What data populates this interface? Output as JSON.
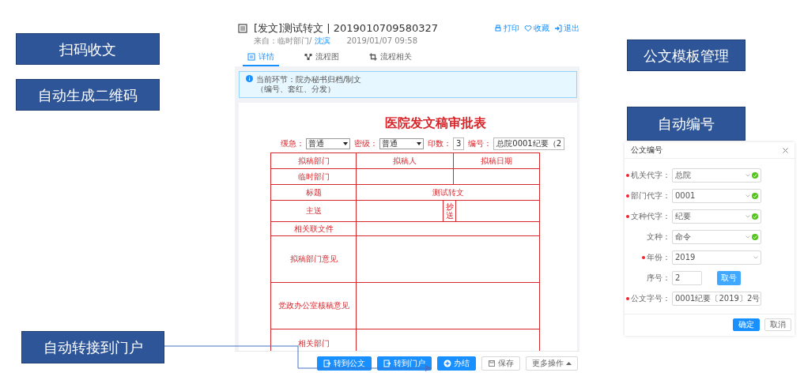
{
  "callouts": [
    "扫码收文",
    "公文模板管理",
    "自动生成二维码",
    "自动编号",
    "自动转接到门户"
  ],
  "document_window": {
    "title": "[发文]测试转文 | 2019010709580327",
    "source_label": "来自：",
    "source_dept": "临时部门/",
    "source_person": "沈滨",
    "time": "2019/01/07 09:58",
    "actions": [
      {
        "kind": "print",
        "label": "打印"
      },
      {
        "kind": "favorite",
        "label": "收藏"
      },
      {
        "kind": "exit",
        "label": "退出"
      }
    ],
    "tabs": [
      {
        "kind": "detail",
        "label": "详情",
        "selected": true
      },
      {
        "kind": "flow",
        "label": "流程图",
        "selected": false
      },
      {
        "kind": "related",
        "label": "流程相关",
        "selected": false
      }
    ],
    "notice": [
      "当前环节：院办秘书归档/制文",
      "（编号、套红、分发）"
    ],
    "form": {
      "title": "医院发文稿审批表",
      "fields": [
        {
          "kind": "select",
          "label": "缓急：",
          "value": "普通"
        },
        {
          "kind": "select",
          "label": "密级：",
          "value": "普通"
        },
        {
          "kind": "input",
          "label": "印数：",
          "value": "3"
        },
        {
          "kind": "input",
          "label": "编号：",
          "value": "总院0001纪要（2"
        }
      ],
      "rows": [
        {
          "kind": "header3",
          "cells": [
            "拟稿部门",
            "拟稿人",
            "拟稿日期"
          ]
        },
        {
          "kind": "label3",
          "label": "临时部门"
        },
        {
          "kind": "label_value",
          "label": "标题",
          "value": "测试转文"
        },
        {
          "kind": "send",
          "label": "主送",
          "cc_label": "抄送"
        },
        {
          "kind": "label",
          "label": "相关联文件"
        },
        {
          "kind": "opinion",
          "label": "拟稿部门意见"
        },
        {
          "kind": "opinion",
          "label": "党政办公室核稿意见"
        },
        {
          "kind": "opinion",
          "label": "相关部门"
        }
      ]
    },
    "buttons": [
      {
        "kind": "forward",
        "label": "转到公文"
      },
      {
        "kind": "forward",
        "label": "转到门户"
      },
      {
        "kind": "finish",
        "label": "办结"
      },
      {
        "kind": "save",
        "label": "保存"
      },
      {
        "kind": "more",
        "label": "更多操作"
      }
    ]
  },
  "numbering_dialog": {
    "title": "公文编号",
    "fields": [
      {
        "kind": "select",
        "label": "机关代字：",
        "value": "总院",
        "required": true,
        "valid": true
      },
      {
        "kind": "select",
        "label": "部门代字：",
        "value": "0001",
        "required": true,
        "valid": true
      },
      {
        "kind": "select",
        "label": "文种代字：",
        "value": "纪要",
        "required": true,
        "valid": true
      },
      {
        "kind": "select",
        "label": "文种：",
        "value": "命令",
        "required": false,
        "valid": true
      },
      {
        "kind": "select",
        "label": "年份：",
        "value": "2019",
        "required": true,
        "valid": false
      },
      {
        "kind": "serial",
        "label": "序号：",
        "value": "2",
        "button": "取号",
        "required": false,
        "valid": false
      },
      {
        "kind": "input",
        "label": "公文字号：",
        "value": "0001纪要〔2019〕2号",
        "required": true,
        "valid": false
      }
    ],
    "buttons": [
      {
        "kind": "primary",
        "label": "确定"
      },
      {
        "kind": "default",
        "label": "取消"
      }
    ]
  }
}
